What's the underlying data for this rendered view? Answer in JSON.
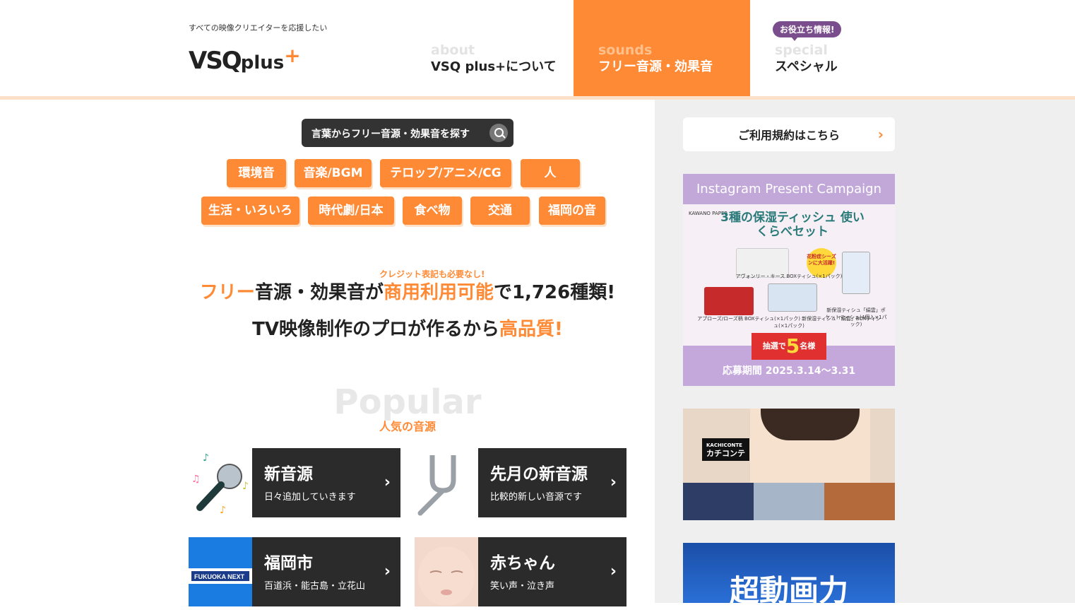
{
  "header": {
    "tagline": "すべての映像クリエイターを応援したい",
    "logo_main": "VSQ",
    "logo_plus": "plus",
    "logo_cross": "+",
    "badge": "お役立ち情報!",
    "nav": [
      {
        "en": "about",
        "ja": "VSQ plus+について"
      },
      {
        "en": "sounds",
        "ja": "フリー音源・効果音"
      },
      {
        "en": "special",
        "ja": "スペシャル"
      }
    ]
  },
  "search": {
    "label": "言葉からフリー音源・効果音を探す",
    "icon": "search-icon"
  },
  "categories": [
    "環境音",
    "音楽/BGM",
    "テロップ/アニメ/CG",
    "人",
    "生活・いろいろ",
    "時代劇/日本",
    "食べ物",
    "交通",
    "福岡の音"
  ],
  "catchcopy": {
    "sub": "クレジット表記も必要なし!",
    "l1_a": "フリー",
    "l1_b": "音源・効果音が",
    "l1_c": "商用利用可能",
    "l1_d": "で1,726種類!",
    "l2_a": "TV映像制作のプロが作るから",
    "l2_b": "高品質!"
  },
  "popular": {
    "en": "Popular",
    "ja": "人気の音源"
  },
  "cards": [
    {
      "title": "新音源",
      "sub": "日々追加していきます"
    },
    {
      "title": "先月の新音源",
      "sub": "比較的新しい音源です"
    },
    {
      "title": "福岡市",
      "sub": "百道浜・能古島・立花山"
    },
    {
      "title": "赤ちゃん",
      "sub": "笑い声・泣き声"
    }
  ],
  "sidebar": {
    "terms": "ご利用規約はこちら",
    "ad1": {
      "top": "Instagram Present Campaign",
      "brand": "KAWANO PAPER",
      "title": "3種の保湿ティッシュ 使いくらべセット",
      "badge_l": "抽選で",
      "badge_n": "5",
      "badge_r": "名様",
      "date": "応募期間 2025.3.14〜3.31",
      "cap1": "アヴォンリー・キース BOXティシュ(×1パック)",
      "cap2": "アプローズ/ローズ柄 BOXティシュ(×1パック) 新保湿ティシュ「絹雲」BOXティシュ(×1パック)",
      "cap3": "新保湿ティシュ「絹雲」ポケットティシュ(4個入×1パック)",
      "sticker": "花粉症シーズンに大活躍!"
    },
    "ad2": {
      "tag_en": "KACHICONTE",
      "tag_ja": "カチコンテ"
    },
    "ad3": {
      "text": "超動画力"
    }
  },
  "colors": {
    "accent": "#ff8a35",
    "dark": "#2b2b2b",
    "badge": "#7a4d8c"
  }
}
